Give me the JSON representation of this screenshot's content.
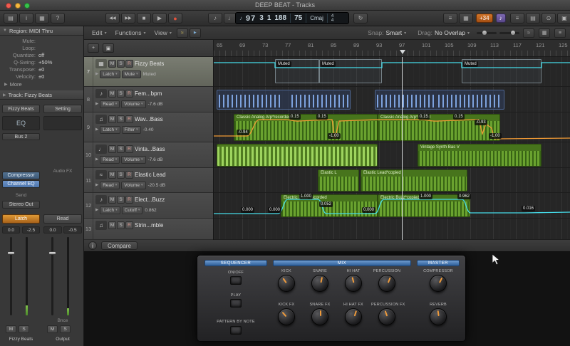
{
  "window": {
    "title": "DEEP BEAT - Tracks"
  },
  "icons": {
    "chevron": "▾",
    "disc_closed": "▶",
    "disc_open": "▼",
    "plus": "+",
    "library": "▤",
    "inspector": "i",
    "toolbar_grid": "▦",
    "quick_help": "?",
    "rewind": "◀◀",
    "forward": "▶▶",
    "stop": "■",
    "play": "▶",
    "record": "●",
    "note": "♪",
    "metronome": "♩",
    "cycle": "↻",
    "list": "≡",
    "grid": "▦",
    "target": "⊙",
    "box": "▣",
    "approx": "≈",
    "info": "i"
  },
  "toolbar": {
    "cpu_badge": "+34",
    "media_badge": "♪"
  },
  "lcd": {
    "bar": "97",
    "beat": "3",
    "division": "1",
    "tick": "188",
    "tempo": "75",
    "key": "Cmaj",
    "sig_top": "4",
    "sig_bottom": "4"
  },
  "menubar": {
    "edit": "Edit",
    "functions": "Functions",
    "view": "View",
    "snap_label": "Snap:",
    "snap_value": "Smart",
    "drag_label": "Drag:",
    "drag_value": "No Overlap"
  },
  "inspector": {
    "region_title": "Region: MIDI Thru",
    "rows": [
      {
        "label": "Mute:",
        "value": ""
      },
      {
        "label": "Loop:",
        "value": ""
      },
      {
        "label": "Quantize:",
        "value": "off"
      },
      {
        "label": "Q-Swing:",
        "value": "+50%"
      },
      {
        "label": "Transpose:",
        "value": "±0"
      },
      {
        "label": "Velocity:",
        "value": "±0"
      }
    ],
    "more_label": "More",
    "track_title": "Track: Fizzy Beats",
    "strip": {
      "name_button": "Fizzy Beats",
      "setting_button": "Setting",
      "eq_label": "EQ",
      "bus_label": "Bus 2",
      "insert1": "Compressor",
      "insert2": "Channel EQ",
      "audio_fx_label": "Audio FX",
      "send_label": "Send",
      "output_slot": "Stereo Out",
      "latch_button": "Latch",
      "read_button": "Read",
      "val_l1": "0.0",
      "val_l2": "-2.5",
      "val_r1": "0.0",
      "val_r2": "-0.5",
      "mute": "M",
      "solo": "S",
      "bounce": "Bnce",
      "strip1_name": "Fizzy Beats",
      "strip2_name": "Output"
    }
  },
  "track_buttons": {
    "m": "M",
    "s": "S",
    "r": "R"
  },
  "tracks": [
    {
      "num": "7",
      "icon": "▦",
      "name": "Fizzy Beats",
      "mode": "Latch",
      "param": "Mute",
      "value": "Muted"
    },
    {
      "num": "8",
      "icon": "♪",
      "name": "Fem...bpm",
      "mode": "Read",
      "param": "Volume",
      "value": "-7.6 dB"
    },
    {
      "num": "9",
      "icon": "♫",
      "name": "Wav...Bass",
      "mode": "Latch",
      "param": "Filter",
      "value": "-0.40"
    },
    {
      "num": "10",
      "icon": "♩",
      "name": "Vinta...Bass",
      "mode": "Read",
      "param": "Volume",
      "value": "-7.6 dB"
    },
    {
      "num": "11",
      "icon": "≈",
      "name": "Elastic Lead",
      "mode": "Read",
      "param": "Volume",
      "value": "-20.5 dB"
    },
    {
      "num": "12",
      "icon": "♪",
      "name": "Elect...Buzz",
      "mode": "Latch",
      "param": "Cutoff",
      "value": "0.862"
    },
    {
      "num": "13",
      "icon": "♫",
      "name": "Strin...mble"
    }
  ],
  "ruler": {
    "marks": [
      "65",
      "69",
      "73",
      "77",
      "81",
      "85",
      "89",
      "93",
      "97",
      "101",
      "105",
      "109",
      "113",
      "117",
      "121",
      "125"
    ]
  },
  "arrange": {
    "muted_labels": [
      "Muted",
      "Muted",
      "Muted"
    ],
    "t3_region1": "Classic Analog Arp*recorded",
    "t3_region2": "Classic Analog Arp*copied",
    "t3_values": [
      "-0.94",
      "0.15",
      "0.15",
      "-1.00",
      "0.15",
      "0.15",
      "-0.93",
      "-1.00"
    ],
    "t4_region2": "Vintage Synth Bas V",
    "t5_region1": "Elastic L",
    "t5_region2": "Elastic Lead*copied",
    "t6_region1": "Electric Buzz*recorded",
    "t6_region2": "Electric Buzz*copied",
    "t6_values": [
      "0.000",
      "0.000",
      "1.000",
      "0.052",
      "0.000",
      "1.000",
      "0.962",
      "0.016"
    ]
  },
  "bottom": {
    "compare_button": "Compare",
    "sections": {
      "sequencer": "SEQUENCER",
      "mix": "MIX",
      "master": "MASTER"
    },
    "seq_controls": [
      "ON/OFF",
      "PLAY",
      "PATTERN BY NOTE"
    ],
    "mix_knobs": [
      "KICK",
      "SNARE",
      "HI HAT",
      "PERCUSSION",
      "KICK FX",
      "SNARE FX",
      "HI HAT FX",
      "PERCUSSION FX"
    ],
    "master_knobs": [
      "COMPRESSOR",
      "REVERB"
    ]
  }
}
